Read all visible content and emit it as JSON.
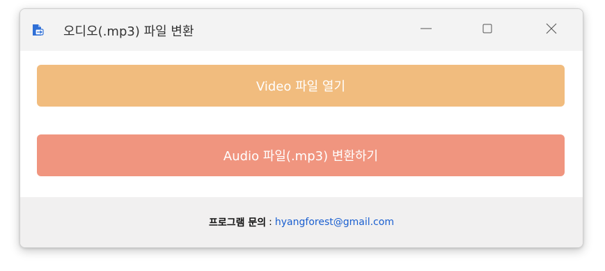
{
  "window": {
    "title": "오디오(.mp3) 파일 변환",
    "icon": "file-convert-icon",
    "controls": {
      "minimize": "minimize-icon",
      "maximize": "maximize-icon",
      "close": "close-icon"
    }
  },
  "actions": {
    "open_video_label": "Video 파일 열기",
    "convert_audio_label": "Audio 파일(.mp3) 변환하기"
  },
  "footer": {
    "label": "프로그램 문의",
    "separator": ":",
    "email": "hyangforest@gmail.com"
  },
  "colors": {
    "open_button": "#f1bc7e",
    "convert_button": "#f0957f",
    "footer_bg": "#f1f0f0",
    "email_link": "#1a5fd0"
  }
}
